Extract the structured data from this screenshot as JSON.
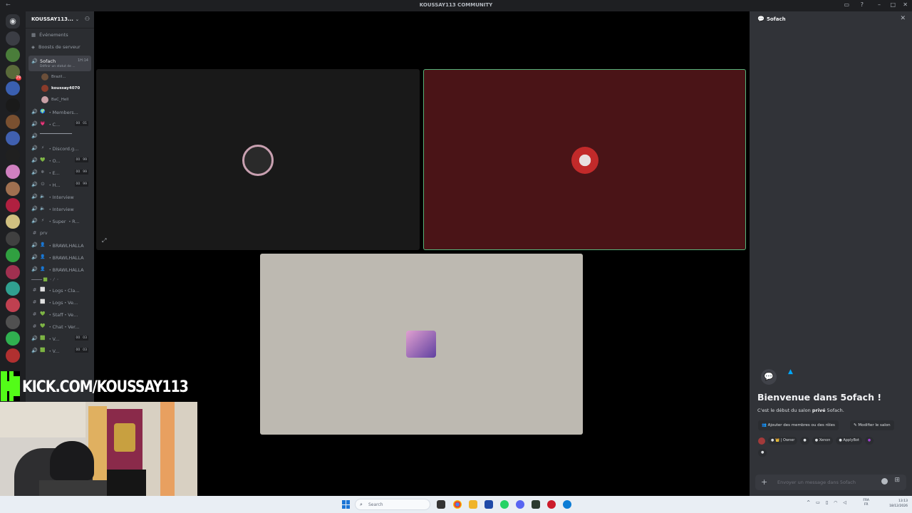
{
  "window": {
    "title": "KOUSSAY113 COMMUNITY"
  },
  "guild": {
    "name": "KOUSSAY113..."
  },
  "menu": [
    {
      "label": "Événements",
      "icon": "calendar-icon"
    },
    {
      "label": "Boosts de serveur",
      "icon": "boost-icon"
    }
  ],
  "active_channel": {
    "name": "5ofach",
    "status": "Définir un statut de ...",
    "time": "1H:14",
    "users": [
      {
        "name": "Brazil...",
        "color": "#6b4f3a",
        "bold": false
      },
      {
        "name": "koussay4070",
        "color": "#8a3b2a",
        "bold": true
      },
      {
        "name": "BaC_Hell",
        "color": "#c9a0a6",
        "bold": false
      }
    ]
  },
  "channels": [
    {
      "type": "voice",
      "emoji": "🌍",
      "name": "・Members...",
      "counts": []
    },
    {
      "type": "voice",
      "emoji": "💗",
      "name": "・C...",
      "counts": [
        "00",
        "01"
      ]
    },
    {
      "type": "voice",
      "emoji": "",
      "name": "▔▔▔▔▔▔▔▔▔",
      "counts": []
    },
    {
      "type": "voice",
      "emoji": "⚡",
      "name": "・Discord.g...",
      "counts": []
    },
    {
      "type": "voice",
      "emoji": "💚",
      "name": "・O...",
      "counts": [
        "00",
        "99"
      ]
    },
    {
      "type": "voice",
      "emoji": "❄",
      "name": "・E...",
      "counts": [
        "00",
        "99"
      ]
    },
    {
      "type": "voice",
      "emoji": "⏻",
      "name": "・H...",
      "counts": [
        "00",
        "99"
      ]
    },
    {
      "type": "voice",
      "emoji": "🔈",
      "name": "・Interview",
      "counts": []
    },
    {
      "type": "voice",
      "emoji": "🔈",
      "name": "・Interview",
      "counts": []
    },
    {
      "type": "voice",
      "emoji": "⚡",
      "name": "・Super ・R...",
      "counts": []
    },
    {
      "type": "text",
      "emoji": "",
      "name": "prv",
      "counts": []
    },
    {
      "type": "voice",
      "emoji": "👤",
      "name": "・BRAWLHALLA",
      "counts": []
    },
    {
      "type": "voice",
      "emoji": "👤",
      "name": "・BRAWLHALLA",
      "counts": []
    },
    {
      "type": "voice",
      "emoji": "👤",
      "name": "・BRAWLHALLA",
      "counts": []
    },
    {
      "type": "category",
      "emoji": "",
      "name": "━━━━━ 🟩 ・〳・",
      "counts": []
    },
    {
      "type": "text",
      "emoji": "⬜",
      "name": "・Logs・Cla...",
      "counts": []
    },
    {
      "type": "text",
      "emoji": "⬜",
      "name": "・Logs・Ve...",
      "counts": []
    },
    {
      "type": "text",
      "emoji": "💚",
      "name": "・Staff・Ve...",
      "counts": []
    },
    {
      "type": "text",
      "emoji": "💚",
      "name": "・Chat・Ver...",
      "counts": []
    },
    {
      "type": "voice",
      "emoji": "🟩",
      "name": "・V...",
      "counts": [
        "00",
        "03"
      ]
    },
    {
      "type": "voice",
      "emoji": "🟩",
      "name": "・V...",
      "counts": [
        "00",
        "03"
      ]
    }
  ],
  "servers": [
    {
      "color": "#3b3d44",
      "badge": ""
    },
    {
      "color": "#4a7d3a",
      "badge": ""
    },
    {
      "color": "#5a6a3a",
      "badge": "29"
    },
    {
      "color": "#3a5fb0",
      "badge": ""
    },
    {
      "color": "#1a1a1a",
      "badge": ""
    },
    {
      "color": "#7a5030",
      "badge": ""
    },
    {
      "color": "#4060b0",
      "badge": ""
    },
    {
      "color": "#202020",
      "badge": ""
    },
    {
      "color": "#d080c0",
      "badge": ""
    },
    {
      "color": "#a07050",
      "badge": ""
    },
    {
      "color": "#b02040",
      "badge": ""
    },
    {
      "color": "#d0c080",
      "badge": ""
    },
    {
      "color": "#404040",
      "badge": ""
    },
    {
      "color": "#30a040",
      "badge": ""
    },
    {
      "color": "#a03050",
      "badge": ""
    },
    {
      "color": "#30a090",
      "badge": ""
    },
    {
      "color": "#c04050",
      "badge": ""
    },
    {
      "color": "#505050",
      "badge": ""
    },
    {
      "color": "#30b050",
      "badge": ""
    },
    {
      "color": "#b03030",
      "badge": ""
    }
  ],
  "voice_tiles": [
    {
      "name": "tile-1",
      "bg": "#191919",
      "avatar_color": "#c8a0b0",
      "speaking": false
    },
    {
      "name": "tile-2",
      "bg": "#4a1417",
      "avatar_color": "#c22a2a",
      "speaking": true
    },
    {
      "name": "tile-3",
      "bg": "#bdb9b1",
      "avatar_color": "#c060a0",
      "speaking": false
    }
  ],
  "right_panel": {
    "title": "5ofach",
    "welcome_title": "Bienvenue dans 5ofach !",
    "welcome_sub_prefix": "C'est le début du salon ",
    "welcome_sub_bold": "privé",
    "welcome_sub_suffix": " 5ofach.",
    "add_members": "Ajouter des membres ou des rôles",
    "edit_channel": "Modifier le salon",
    "tags": [
      "● 👑 | Owner",
      "●",
      "● Xenon",
      "● ApplyBot"
    ],
    "tag_extra": "●",
    "composer_placeholder": "Envoyer un message dans 5ofach"
  },
  "overlay": {
    "kick_text": "KICK.COM/KOUSSAY113"
  },
  "taskbar": {
    "search": "Search",
    "lang_top": "FRA",
    "lang_bottom": "FR",
    "time": "13:13",
    "date": "18/12/2026"
  }
}
